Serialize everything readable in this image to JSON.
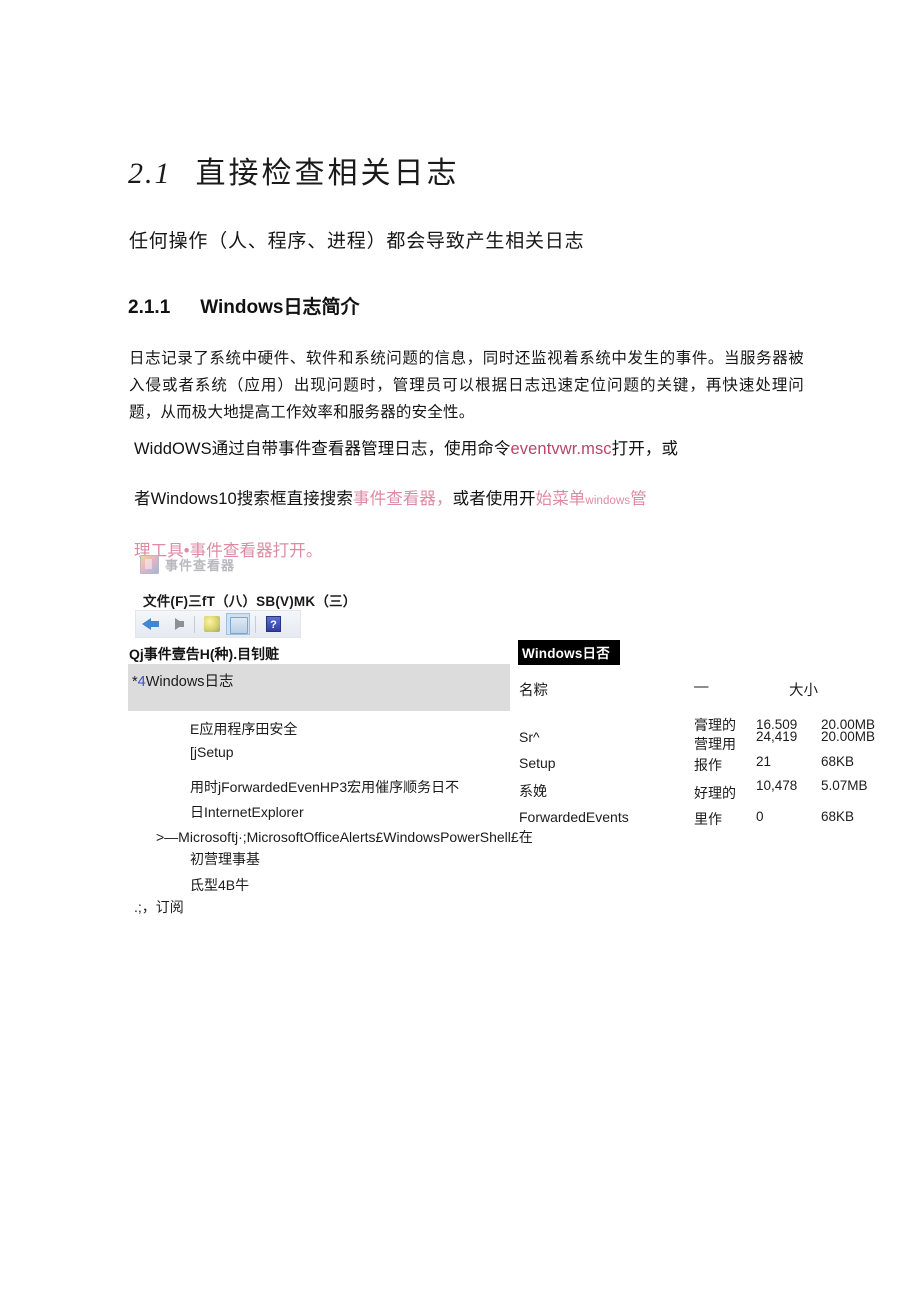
{
  "document": {
    "heading1": {
      "number": "2.1",
      "text": "直接检查相关日志"
    },
    "lead": "任何操作（人、程序、进程）都会导致产生相关日志",
    "heading2": {
      "number": "2.1.1",
      "text": "Windows日志简介"
    },
    "paragraph_intro": "日志记录了系统中硬件、软件和系统问题的信息，同时还监视着系统中发生的事件。当服务器被入侵或者系统（应用）出现问题时，管理员可以根据日志迅速定位问题的关键，再快速处理问题，从而极大地提高工作效率和服务器的安全性。",
    "paragraph_howto": {
      "seg1": "WiddOWS通过自带事件查看器管理日志，使用命令",
      "cmd": "eventvwr.msc",
      "seg2": "打开，或",
      "seg3": "者Windows10搜索框直接搜索",
      "link1": "事件查看器，",
      "seg4": "或者使用开",
      "link2": "始菜单",
      "link2_small": "windows",
      "link3": "管",
      "link4": "理工具•事件查看器打开。"
    }
  },
  "screenshot": {
    "window_title": "事件查看器",
    "menubar": "文件(F)三fT（八）SB(V)MK（三）",
    "toolbar": {
      "back": "back-arrow",
      "forward": "forward-arrow",
      "action": "green-action-icon",
      "view": "selected-view-icon",
      "help": "?"
    },
    "tree": {
      "header": "Qj事件壹告H(种).目钊赃",
      "root": {
        "prefix": "*",
        "marker": "4",
        "label": "Windows日志"
      },
      "items": [
        "E应用程序田安全",
        "[jSetup",
        "用时jForwardedEvenHP3宏用催序顺务日不",
        "日InternetExplorer",
        ">—Microsoftj·;MicrosoftOfficeAlerts£WindowsPowerShell£在",
        "初营理事基",
        "氐型4B牛",
        ".;，订阅"
      ]
    },
    "details": {
      "badge": "Windows日否",
      "columns": {
        "name": "名粽",
        "type": "—",
        "size": "大小"
      },
      "rows": [
        {
          "name": "",
          "type": "膏理的",
          "count": "16.509",
          "size": "20.00MB"
        },
        {
          "name": "Sr^",
          "type": "营理用",
          "count": "24,419",
          "size": "20.00MB"
        },
        {
          "name": "Setup",
          "type": "报作",
          "count": "21",
          "size": "68KB"
        },
        {
          "name": "系娩",
          "type": "好理的",
          "count": "10,478",
          "size": "5.07MB"
        },
        {
          "name": "ForwardedEvents",
          "type": "里作",
          "count": "0",
          "size": "68KB"
        }
      ]
    }
  },
  "colors": {
    "pink_strong": "#b8456b",
    "pink_soft": "#dd8ba4",
    "tree_highlight": "#dcdcdc",
    "badge_bg": "#000000"
  }
}
